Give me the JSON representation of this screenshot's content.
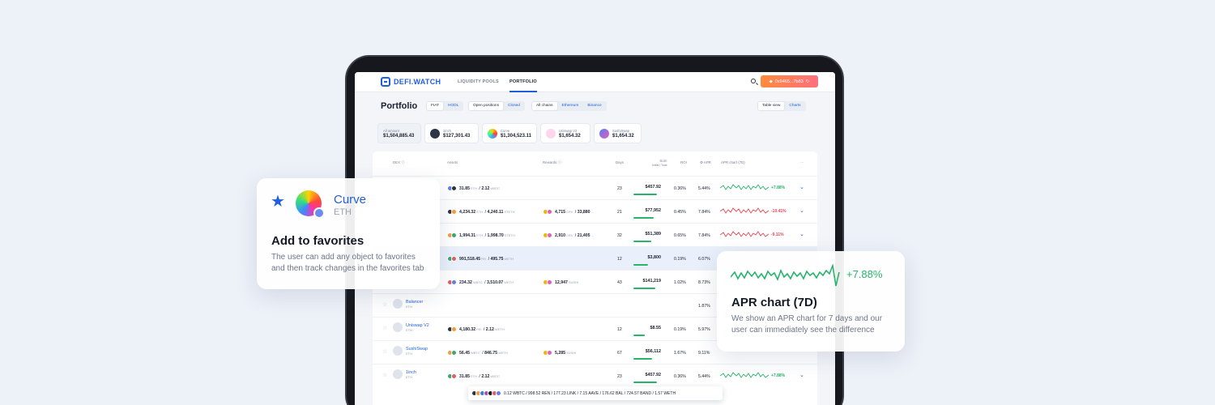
{
  "nav": {
    "logo": "DEFI.WATCH",
    "links": [
      "LIQUIDITY POOLS",
      "PORTFOLIO"
    ],
    "wallet": "0x9465...7b83"
  },
  "portfolio": {
    "title": "Portfolio",
    "mode": [
      "FIAT",
      "HODL"
    ],
    "status": [
      "Open positions",
      "Closed"
    ],
    "chains": [
      "All chains",
      "Ethereum",
      "Binance"
    ],
    "view": [
      "Table view",
      "Charts"
    ]
  },
  "summary": [
    {
      "label": "All amount",
      "value": "$1,504,885.43"
    },
    {
      "label": "1inch",
      "value": "$127,301.43"
    },
    {
      "label": "Curve",
      "value": "$1,304,523.11"
    },
    {
      "label": "Uniswap V2",
      "value": "$1,654.32"
    },
    {
      "label": "SushiSwap",
      "value": "$1,654.32"
    }
  ],
  "table": {
    "headers": {
      "dex": "DEX",
      "assets": "Assets",
      "rewards": "Rewards",
      "days": "Days",
      "sum": "Sum",
      "sum2": "Initial | Total",
      "roi": "ROI",
      "apr": "APR",
      "aprchart": "APR chart (7D)",
      "more": "···"
    },
    "rows": [
      {
        "name": "",
        "chain": "",
        "assets": [
          {
            "n": "31.85",
            "u": "ETH"
          },
          {
            "n": "2.12",
            "u": "WBTC"
          }
        ],
        "rewards": [],
        "days": "23",
        "sum": "$457.92",
        "fill": 0.8,
        "roi": "0.36%",
        "apr": "5.44%",
        "pct": "+7.88%",
        "trend": "up"
      },
      {
        "name": "",
        "chain": "",
        "assets": [
          {
            "n": "4,234.32",
            "u": "ETH"
          },
          {
            "n": "4,240.11",
            "u": "STETH"
          }
        ],
        "rewards": [
          {
            "n": "4,715",
            "u": "CRV"
          },
          {
            "n": "33,880",
            "u": "..."
          }
        ],
        "days": "21",
        "sum": "$77,952",
        "fill": 0.7,
        "roi": "0.45%",
        "apr": "7.84%",
        "pct": "-10.41%",
        "trend": "down"
      },
      {
        "name": "",
        "chain": "",
        "assets": [
          {
            "n": "1,994.31",
            "u": "ETH"
          },
          {
            "n": "1,998.70",
            "u": "STETH"
          }
        ],
        "rewards": [
          {
            "n": "2,910",
            "u": "CRV"
          },
          {
            "n": "21,405",
            "u": "..."
          }
        ],
        "days": "32",
        "sum": "$51,389",
        "fill": 0.6,
        "roi": "0.65%",
        "apr": "7.84%",
        "pct": "-9.11%",
        "trend": "down"
      },
      {
        "name": "",
        "chain": "",
        "assets": [
          {
            "n": "991,518.45",
            "u": "FEI"
          },
          {
            "n": "495.75",
            "u": "WETH"
          }
        ],
        "rewards": [],
        "days": "12",
        "sum": "$3,800",
        "fill": 0.5,
        "roi": "0.19%",
        "apr": "6.07%",
        "pct": "",
        "trend": ""
      },
      {
        "name": "",
        "chain": "",
        "assets": [
          {
            "n": "234.32",
            "u": "WBTC"
          },
          {
            "n": "3,510.07",
            "u": "WETH"
          }
        ],
        "rewards": [
          {
            "n": "12,947",
            "u": "SUSHI"
          }
        ],
        "days": "43",
        "sum": "$141,219",
        "fill": 0.75,
        "roi": "1.02%",
        "apr": "8.73%",
        "pct": "",
        "trend": ""
      },
      {
        "name": "Balancer",
        "chain": "ETH",
        "assets": [],
        "rewards": [],
        "days": "",
        "sum": "",
        "fill": 0,
        "roi": "",
        "apr": "1.87%",
        "pct": "",
        "trend": ""
      },
      {
        "name": "Uniswap V2",
        "chain": "ETH",
        "assets": [
          {
            "n": "4,180.32",
            "u": "FEI"
          },
          {
            "n": "2.12",
            "u": "WETH"
          }
        ],
        "rewards": [],
        "days": "12",
        "sum": "$8.55",
        "fill": 0.4,
        "roi": "0.19%",
        "apr": "5.97%",
        "pct": "",
        "trend": ""
      },
      {
        "name": "SushiSwap",
        "chain": "ETH",
        "assets": [
          {
            "n": "56.45",
            "u": "WBTC"
          },
          {
            "n": "846.75",
            "u": "WETH"
          }
        ],
        "rewards": [
          {
            "n": "5,285",
            "u": "SUSHI"
          }
        ],
        "days": "67",
        "sum": "$56,112",
        "fill": 0.65,
        "roi": "1.67%",
        "apr": "9.11%",
        "pct": "",
        "trend": ""
      },
      {
        "name": "1inch",
        "chain": "ETH",
        "assets": [
          {
            "n": "31.85",
            "u": "ETH"
          },
          {
            "n": "2.12",
            "u": "WBTC"
          }
        ],
        "rewards": [],
        "days": "23",
        "sum": "$457.92",
        "fill": 0.8,
        "roi": "0.36%",
        "apr": "5.44%",
        "pct": "+7.88%",
        "trend": "up"
      }
    ],
    "tooltip": "0.12 WBTC / 998.52 REN / 177.23 LINK / 7.15 AAVE / 176.62 BAL / 724.57 BAND / 1.57 WETH"
  },
  "fav_card": {
    "protocol": "Curve",
    "chain": "ETH",
    "title": "Add to favorites",
    "text": "The user can add any object to favorites and then track changes in the favorites tab"
  },
  "apr_card": {
    "pct": "+7.88%",
    "title": "APR chart (7D)",
    "text": "We show an APR chart for 7 days and our user can immediately see the difference"
  },
  "colors": {
    "accent": "#1f5fdc",
    "up": "#27b46b",
    "down": "#e64552",
    "wallet": "#ff7a52"
  }
}
